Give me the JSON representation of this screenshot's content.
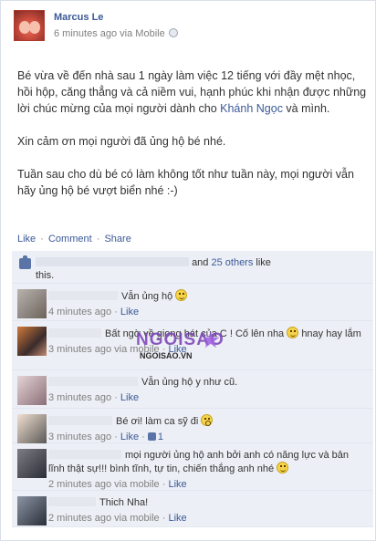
{
  "post": {
    "author": "Marcus Le",
    "time": "6 minutes ago",
    "via": "via Mobile",
    "paragraph1_a": "Bé vừa về đến nhà sau 1 ngày làm việc 12 tiếng với đầy mệt nhọc, hồi hộp, căng thẳng và cả niềm vui, hạnh phúc khi nhận được những lời chúc mừng của mọi người dành cho ",
    "paragraph1_link": "Khánh Ngọc",
    "paragraph1_b": " và mình.",
    "paragraph2": "Xin cảm ơn mọi người đã ủng hộ bé nhé.",
    "paragraph3": "Tuần sau cho dù bé có làm không tốt như tuần này, mọi người vẫn hãy ủng hộ bé vượt biển nhé :-)"
  },
  "actions": {
    "like": "Like",
    "comment": "Comment",
    "share": "Share",
    "dot": "·"
  },
  "likes": {
    "and": "and",
    "others_link": "25 others",
    "suffix": "like",
    "this": "this."
  },
  "comments": [
    {
      "text": "Vẫn ủng hộ",
      "time": "4 minutes ago",
      "like": "Like"
    },
    {
      "text": "Bất ngờ về giọng hát của C ! Cố lên nha",
      "text2": "hnay hay lắm",
      "time": "3 minutes ago via mobile",
      "like": "Like"
    },
    {
      "text": "Vẫn ủng hộ y như cũ.",
      "time": "3 minutes ago",
      "like": "Like"
    },
    {
      "text": "Bé ơi! làm ca sỹ đi",
      "time": "3 minutes ago",
      "like": "Like",
      "like_count": "1"
    },
    {
      "text": "mọi người ủng hộ anh bởi anh có năng lực và bản lĩnh thật sự!!! bình tĩnh, tự tin, chiến thắng anh nhé",
      "time": "2 minutes ago via mobile",
      "like": "Like"
    },
    {
      "text": "Thich Nha!",
      "time": "2 minutes ago via mobile",
      "like": "Like"
    }
  ],
  "watermark": {
    "main": "NGOISAO",
    "sub": "NGOISAO.VN"
  },
  "colors": {
    "link": "#3b5998",
    "ufi_bg": "#eceff5",
    "meta": "#808080"
  },
  "icons": [
    "globe-icon",
    "thumbs-up-icon",
    "smiley-icon",
    "like-icon"
  ]
}
